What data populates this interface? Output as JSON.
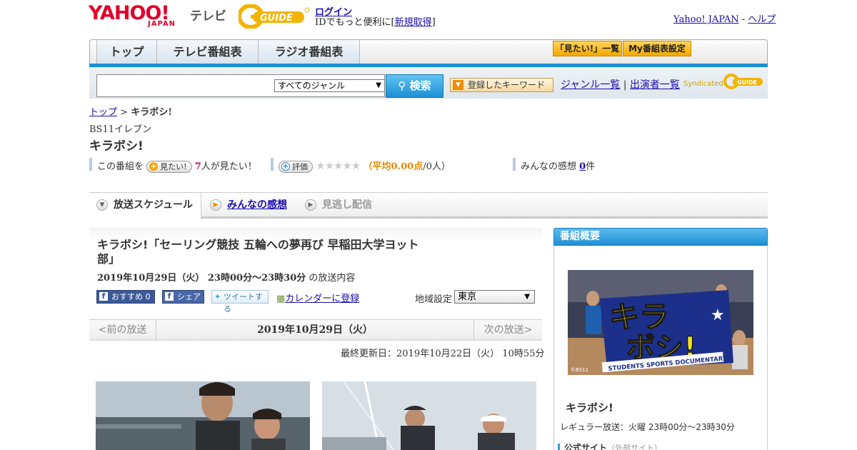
{
  "header": {
    "logo_main": "YAHOO!",
    "logo_sub": "JAPAN",
    "logo_tv": "テレビ",
    "gguide": "G-GUIDE",
    "login": "ログイン",
    "login_sub_prefix": "IDでもっと便利に[",
    "register": "新規取得",
    "login_sub_suffix": "]",
    "yahoo_japan": "Yahoo! JAPAN",
    "sep": " - ",
    "help": "ヘルプ"
  },
  "nav": {
    "tabs": [
      "トップ",
      "テレビ番組表",
      "ラジオ番組表"
    ],
    "want_list": "「見たい!」一覧",
    "my_schedule": "My番組表設定"
  },
  "search": {
    "genre": "すべてのジャンル",
    "button": "検索",
    "keywords": "登録したキーワード",
    "genre_list": "ジャンル一覧",
    "divider": "|",
    "cast_list": "出演者一覧",
    "syndicated": "Syndicated"
  },
  "breadcrumb": {
    "top": "トップ",
    "sep": " > ",
    "current": "キラボシ!"
  },
  "program": {
    "channel": "BS11イレブン",
    "title": "キラボシ!",
    "want_prefix": "この番組を",
    "want_button": "見たい!",
    "want_count": "7",
    "want_suffix": "人が見たい！",
    "rate_button": "評価",
    "stars": "★★★★★",
    "avg_open": "（",
    "avg_label": "平均0.00点",
    "avg_people": "/0人）",
    "impressions_label": "みんなの感想",
    "impressions_count": "0",
    "impressions_unit": "件"
  },
  "tabs": [
    {
      "label": "放送スケジュール",
      "icon": "▼"
    },
    {
      "label": "みんなの感想",
      "icon": "▶"
    },
    {
      "label": "見逃し配信",
      "icon": "▶"
    }
  ],
  "episode": {
    "title": "キラボシ!「セーリング競技 五輪への夢再び 早稲田大学ヨット部」",
    "date": "2019年10月29日（火） 23時00分～23時30分",
    "date_suffix": " の放送内容",
    "fb_recommend": "おすすめ 0",
    "fb_share": "シェア",
    "tweet": "ツイートする",
    "calendar": "カレンダーに登録",
    "region_label": "地域設定",
    "region": "東京"
  },
  "date_nav": {
    "prev": "<前の放送",
    "current": "2019年10月29日（火）",
    "next": "次の放送>"
  },
  "updated": "最終更新日：2019年10月22日（火） 10時55分",
  "sidebar": {
    "heading": "番組概要",
    "logo_text_1": "キラ",
    "logo_text_2": "ボシ!",
    "logo_banner": "STUDENTS SPORTS DOCUMENTARY",
    "copyright": "©BS11",
    "title": "キラボシ!",
    "regular": "レギュラー放送：火曜 23時00分～23時30分",
    "site": "公式サイト",
    "site_ext": "（外部サイト）"
  },
  "colors": {
    "accent_blue": "#1a8fd6",
    "yahoo_red": "#e0002a",
    "gguide_yellow": "#f3b400",
    "link": "#1a0dab"
  }
}
